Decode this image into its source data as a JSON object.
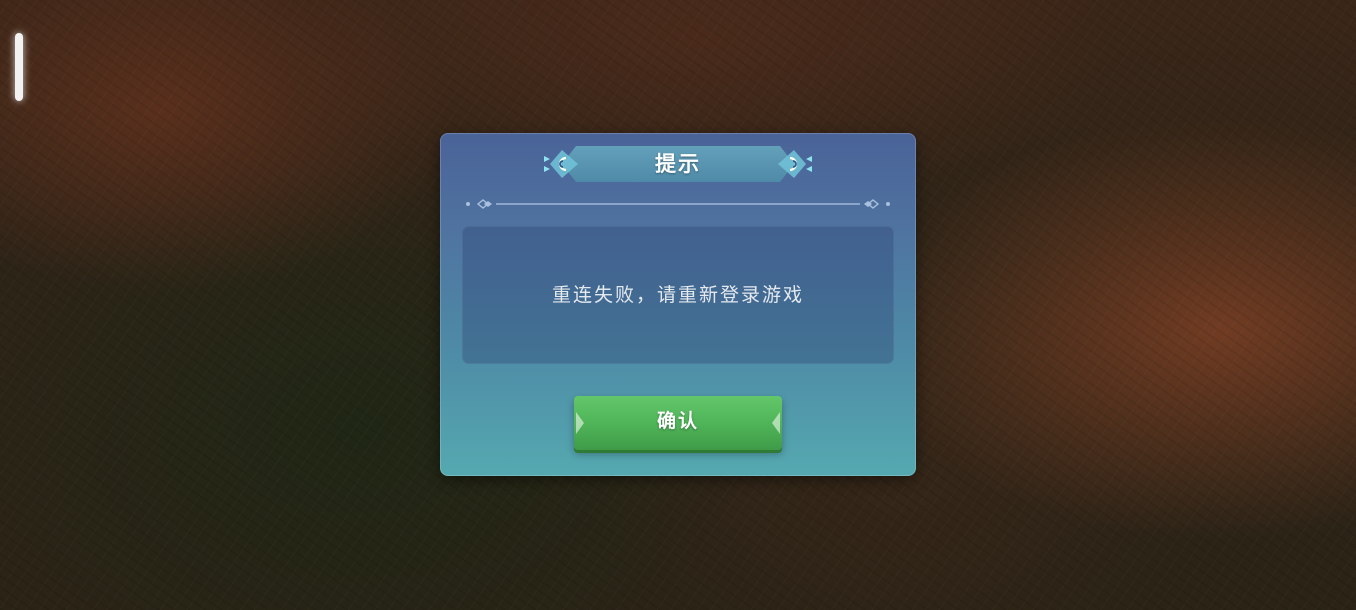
{
  "dialog": {
    "title": "提示",
    "message": "重连失败，请重新登录游戏",
    "confirm_label": "确认"
  },
  "icons": {
    "side_handle": "vertical-bar-handle-icon",
    "title_left": "swirl-ornament-icon",
    "title_right": "swirl-ornament-icon",
    "divider": "diamond-divider-icon",
    "button_chevrons": "chevron-arrow-icon"
  },
  "colors": {
    "dialog_top": "#4a6398",
    "dialog_bottom": "#55a9b0",
    "title_banner": "#63a0ba",
    "button_green": "#4eb257",
    "text_light": "#e4e9f0"
  }
}
